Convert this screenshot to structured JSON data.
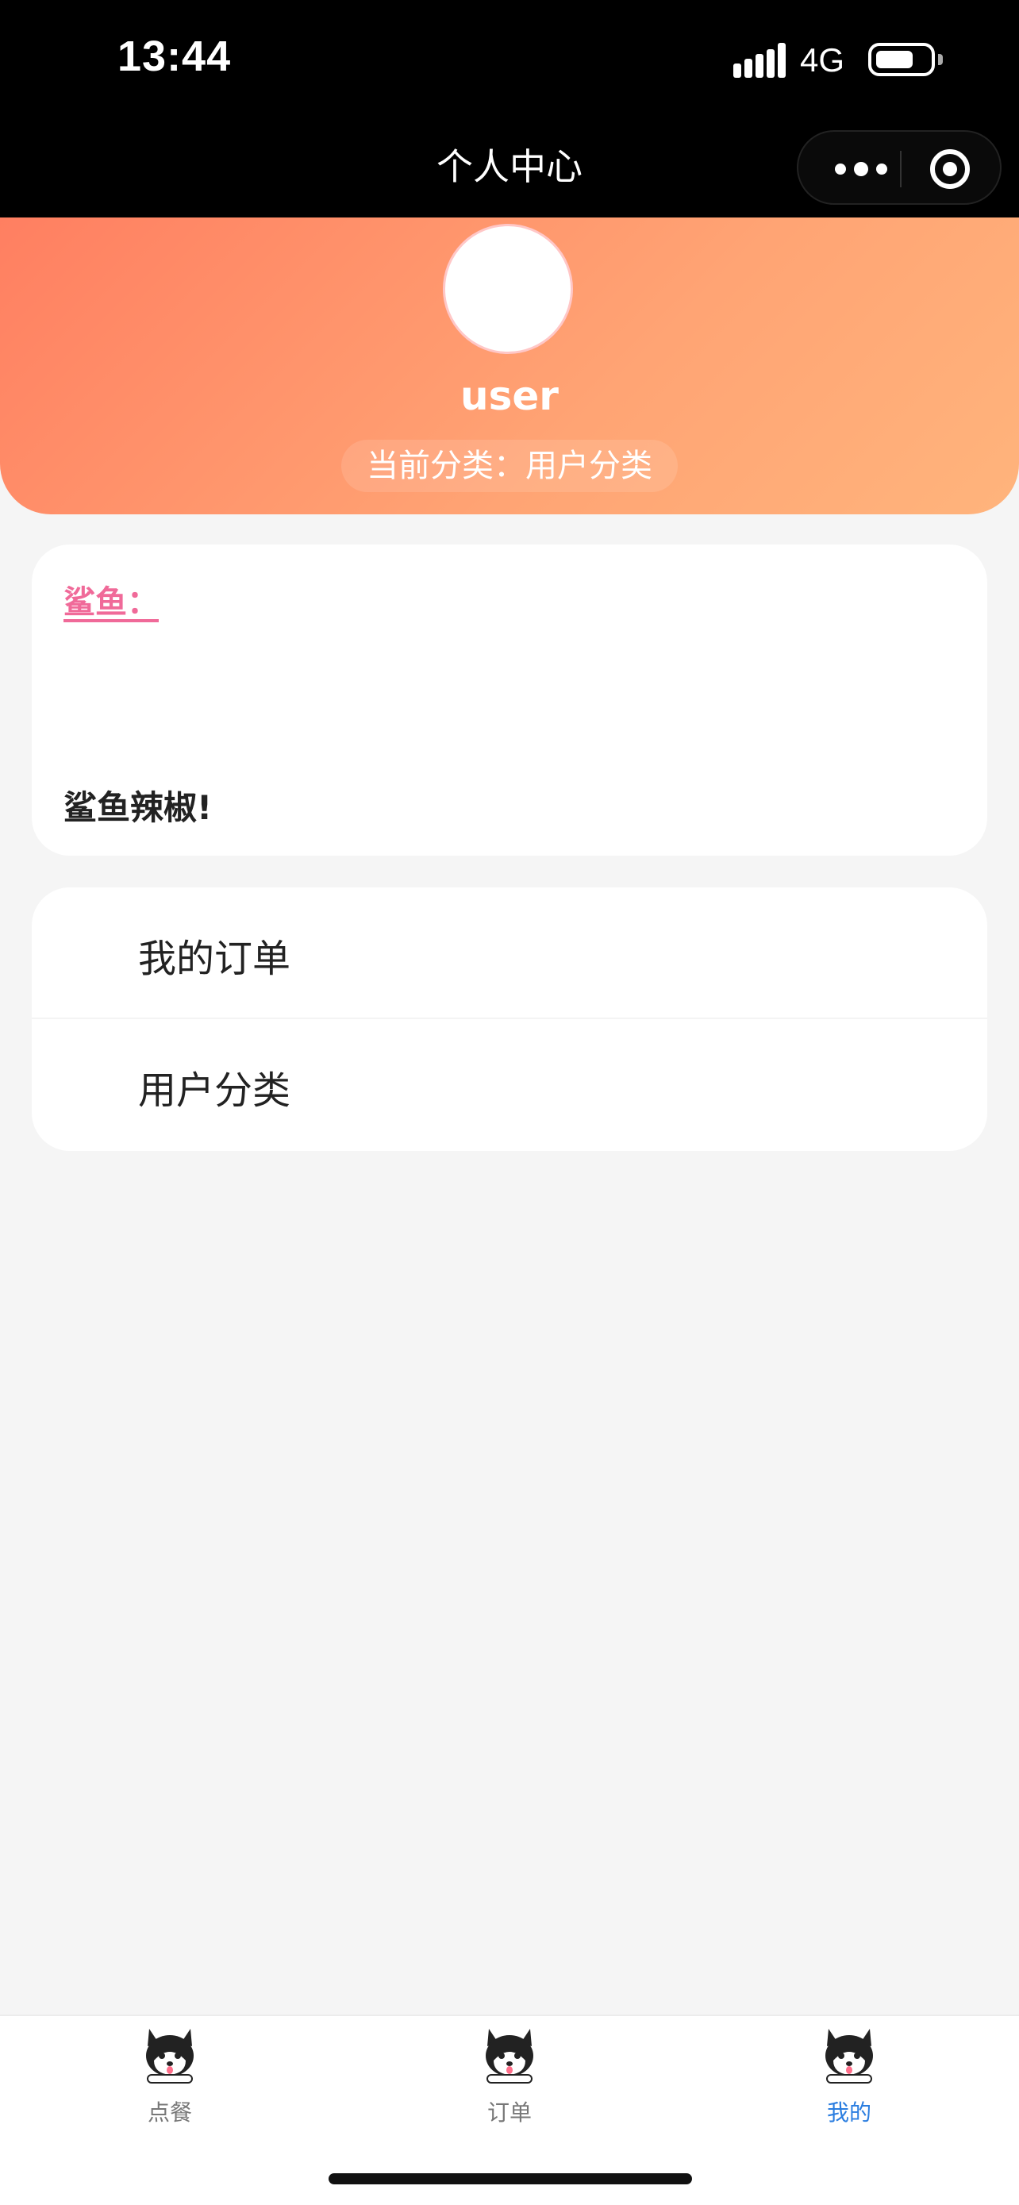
{
  "status_bar": {
    "time": "13:44",
    "network": "4G"
  },
  "nav": {
    "title": "个人中心"
  },
  "profile": {
    "username": "user",
    "category_text": "当前分类：用户分类"
  },
  "notice": {
    "label": "鲨鱼：",
    "message": "鲨鱼辣椒!"
  },
  "menu": [
    {
      "label": "我的订单"
    },
    {
      "label": "用户分类"
    }
  ],
  "tabbar": [
    {
      "label": "点餐",
      "icon": "husky-dog-icon",
      "active": false
    },
    {
      "label": "订单",
      "icon": "husky-dog-icon",
      "active": false
    },
    {
      "label": "我的",
      "icon": "husky-dog-icon",
      "active": true
    }
  ],
  "colors": {
    "hero_gradient_start": "#ff7f61",
    "hero_gradient_end": "#ffb47c",
    "notice_label": "#f06a99",
    "tab_active": "#2a7de0"
  }
}
